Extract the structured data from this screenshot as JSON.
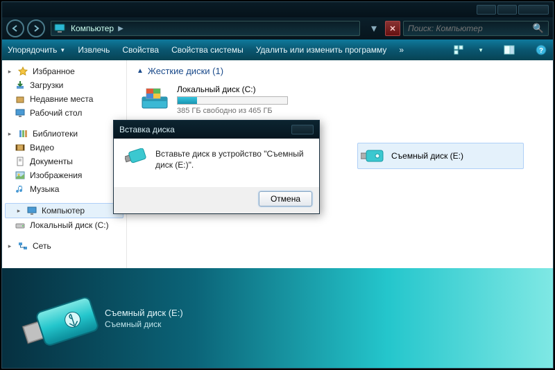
{
  "addressbar": {
    "location": "Компьютер"
  },
  "search": {
    "placeholder": "Поиск: Компьютер"
  },
  "toolbar": {
    "organize": "Упорядочить",
    "eject": "Извлечь",
    "properties": "Свойства",
    "sysprops": "Свойства системы",
    "uninstall": "Удалить или изменить программу",
    "more": "»"
  },
  "sidebar": {
    "favorites": {
      "label": "Избранное",
      "downloads": "Загрузки",
      "recent": "Недавние места",
      "desktop": "Рабочий стол"
    },
    "libraries": {
      "label": "Библиотеки",
      "videos": "Видео",
      "documents": "Документы",
      "pictures": "Изображения",
      "music": "Музыка"
    },
    "computer": {
      "label": "Компьютер",
      "local_c": "Локальный диск (C:)"
    },
    "network": {
      "label": "Сеть"
    }
  },
  "content": {
    "section_hdd_label": "Жесткие диски (1)",
    "local_c": {
      "name": "Локальный диск (C:)",
      "free_text": "385 ГБ свободно из 465 ГБ"
    },
    "removable_e": {
      "name": "Съемный диск (E:)"
    }
  },
  "dialog": {
    "title": "Вставка диска",
    "message": "Вставьте диск в устройство \"Съемный диск (E:)\".",
    "cancel": "Отмена"
  },
  "details": {
    "title": "Съемный диск (E:)",
    "subtitle": "Съемный диск"
  }
}
